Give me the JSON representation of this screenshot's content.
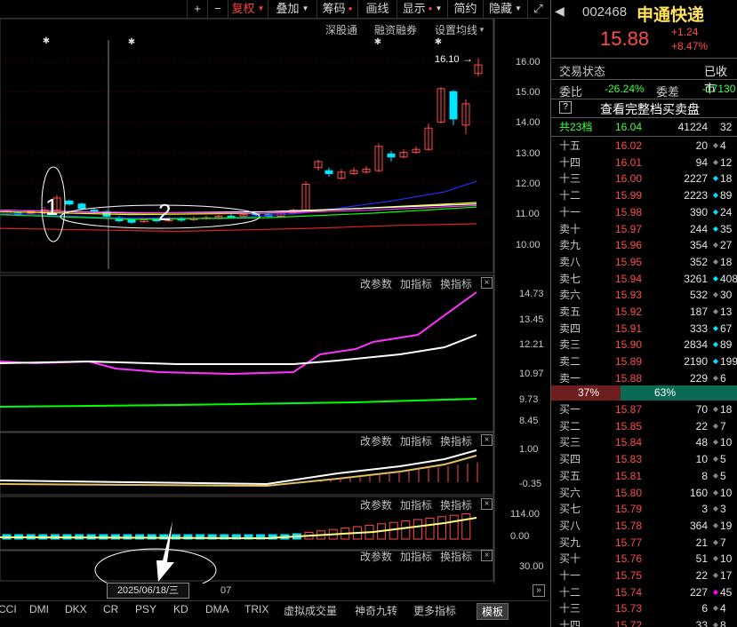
{
  "toolbar": {
    "buttons": [
      {
        "label": "+"
      },
      {
        "label": "−"
      },
      {
        "label": "复权",
        "active": true,
        "caret": true
      },
      {
        "label": "叠加",
        "caret": true
      },
      {
        "label": "筹码",
        "dot": true
      },
      {
        "label": "画线"
      },
      {
        "label": "显示",
        "dot": true,
        "caret": true
      },
      {
        "label": "简约"
      },
      {
        "label": "隐藏",
        "caret": true
      }
    ]
  },
  "chart_header": {
    "links": [
      "深股通",
      "融资融券",
      "设置均线"
    ],
    "high_annotation": "16.10"
  },
  "annotations": {
    "circle1": "1",
    "circle2": "2"
  },
  "price_axis": [
    "16.00",
    "15.00",
    "14.00",
    "13.00",
    "12.00",
    "11.00",
    "10.00"
  ],
  "panel_ctrls": {
    "param": "改参数",
    "add": "加指标",
    "switch": "换指标"
  },
  "panel2_axis": [
    "14.73",
    "13.45",
    "12.21",
    "10.97",
    "9.73",
    "8.45"
  ],
  "panel3_axis": [
    "1.00",
    "-0.35"
  ],
  "panel4_axis": [
    "114.00",
    "0.00"
  ],
  "panel5_axis": [
    "30.00"
  ],
  "date_box": "2025/06/18/三",
  "date_month": "07",
  "tabs": [
    "CCI",
    "DMI",
    "DKX",
    "CR",
    "PSY",
    "KD",
    "DMA",
    "TRIX",
    "虚拟成交量",
    "神奇九转",
    "更多指标",
    "模板"
  ],
  "active_tab": "模板",
  "stock": {
    "code": "002468",
    "name": "申通快递",
    "price": "15.88",
    "change": "+1.24",
    "change_pct": "+8.47%"
  },
  "trade_status": {
    "label": "交易状态",
    "value": "已收市"
  },
  "weibi": {
    "label": "委比",
    "value": "-26.24%",
    "label2": "委差",
    "value2": "-17130"
  },
  "full_book_link": {
    "q": "?",
    "label": "查看完整档买卖盘"
  },
  "total_levels": {
    "label": "共23档",
    "price": "16.04",
    "vol": "41224",
    "extra": "32"
  },
  "sell_levels": [
    {
      "lbl": "十五",
      "price": "16.02",
      "vol": "20",
      "dot": "g",
      "extra": "4"
    },
    {
      "lbl": "十四",
      "price": "16.01",
      "vol": "94",
      "dot": "g",
      "extra": "12"
    },
    {
      "lbl": "十三",
      "price": "16.00",
      "vol": "2227",
      "dot": "c",
      "extra": "18"
    },
    {
      "lbl": "十二",
      "price": "15.99",
      "vol": "2223",
      "dot": "c",
      "extra": "89"
    },
    {
      "lbl": "十一",
      "price": "15.98",
      "vol": "390",
      "dot": "c",
      "extra": "24"
    },
    {
      "lbl": "卖十",
      "price": "15.97",
      "vol": "244",
      "dot": "c",
      "extra": "35"
    },
    {
      "lbl": "卖九",
      "price": "15.96",
      "vol": "354",
      "dot": "g",
      "extra": "27"
    },
    {
      "lbl": "卖八",
      "price": "15.95",
      "vol": "352",
      "dot": "g",
      "extra": "18"
    },
    {
      "lbl": "卖七",
      "price": "15.94",
      "vol": "3261",
      "dot": "c",
      "extra": "408"
    },
    {
      "lbl": "卖六",
      "price": "15.93",
      "vol": "532",
      "dot": "g",
      "extra": "30"
    },
    {
      "lbl": "卖五",
      "price": "15.92",
      "vol": "187",
      "dot": "g",
      "extra": "13"
    },
    {
      "lbl": "卖四",
      "price": "15.91",
      "vol": "333",
      "dot": "c",
      "extra": "67"
    },
    {
      "lbl": "卖三",
      "price": "15.90",
      "vol": "2834",
      "dot": "c",
      "extra": "89"
    },
    {
      "lbl": "卖二",
      "price": "15.89",
      "vol": "2190",
      "dot": "c",
      "extra": "199"
    },
    {
      "lbl": "卖一",
      "price": "15.88",
      "vol": "229",
      "dot": "g",
      "extra": "6"
    }
  ],
  "ratio_bar": {
    "sell_pct": "37%",
    "buy_pct": "63%",
    "sell_fraction": 0.37
  },
  "buy_levels": [
    {
      "lbl": "买一",
      "price": "15.87",
      "vol": "70",
      "dot": "g",
      "extra": "18"
    },
    {
      "lbl": "买二",
      "price": "15.85",
      "vol": "22",
      "dot": "g",
      "extra": "7"
    },
    {
      "lbl": "买三",
      "price": "15.84",
      "vol": "48",
      "dot": "g",
      "extra": "10"
    },
    {
      "lbl": "买四",
      "price": "15.83",
      "vol": "10",
      "dot": "g",
      "extra": "5"
    },
    {
      "lbl": "买五",
      "price": "15.81",
      "vol": "8",
      "dot": "g",
      "extra": "5"
    },
    {
      "lbl": "买六",
      "price": "15.80",
      "vol": "160",
      "dot": "g",
      "extra": "10"
    },
    {
      "lbl": "买七",
      "price": "15.79",
      "vol": "3",
      "dot": "g",
      "extra": "3"
    },
    {
      "lbl": "买八",
      "price": "15.78",
      "vol": "364",
      "dot": "g",
      "extra": "19"
    },
    {
      "lbl": "买九",
      "price": "15.77",
      "vol": "21",
      "dot": "g",
      "extra": "7"
    },
    {
      "lbl": "买十",
      "price": "15.76",
      "vol": "51",
      "dot": "g",
      "extra": "10"
    },
    {
      "lbl": "十一",
      "price": "15.75",
      "vol": "22",
      "dot": "g",
      "extra": "17"
    },
    {
      "lbl": "十二",
      "price": "15.74",
      "vol": "227",
      "dot": "m",
      "extra": "45"
    },
    {
      "lbl": "十三",
      "price": "15.73",
      "vol": "6",
      "dot": "g",
      "extra": "4"
    },
    {
      "lbl": "十四",
      "price": "15.72",
      "vol": "33",
      "dot": "g",
      "extra": "8"
    }
  ],
  "colors": {
    "up": "#ff4b4b",
    "down": "#00e5ff",
    "ma_white": "#ffffff",
    "ma_yellow": "#ffff00",
    "ma_magenta": "#ff33ff",
    "ma_green": "#00ff00",
    "ma_blue": "#2a2aff",
    "ma_red": "#e02020"
  }
}
